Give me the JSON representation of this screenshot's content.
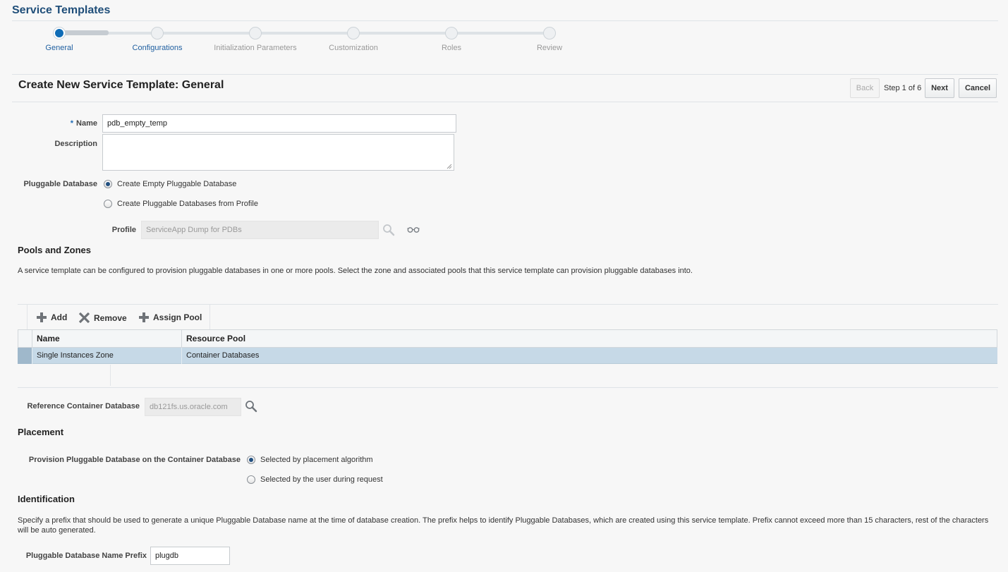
{
  "page_title": "Service Templates",
  "train": {
    "steps": [
      {
        "label": "General",
        "state": "active"
      },
      {
        "label": "Configurations",
        "state": "visited"
      },
      {
        "label": "Initialization Parameters",
        "state": "future"
      },
      {
        "label": "Customization",
        "state": "future"
      },
      {
        "label": "Roles",
        "state": "future"
      },
      {
        "label": "Review",
        "state": "future"
      }
    ]
  },
  "header": {
    "title": "Create New Service Template: General",
    "back_label": "Back",
    "step_text": "Step 1 of 6",
    "next_label": "Next",
    "cancel_label": "Cancel"
  },
  "form": {
    "required_mark": "*",
    "name_label": "Name",
    "name_value": "pdb_empty_temp",
    "description_label": "Description",
    "description_value": "",
    "pdb_label": "Pluggable Database",
    "pdb_options": [
      {
        "label": "Create Empty Pluggable Database",
        "selected": true
      },
      {
        "label": "Create Pluggable Databases from Profile",
        "selected": false
      }
    ],
    "profile_label": "Profile",
    "profile_value": "ServiceApp Dump for PDBs"
  },
  "pools": {
    "title": "Pools and Zones",
    "description": "A service template can be configured to provision pluggable databases in one or more pools. Select the zone and associated pools that this service template can provision pluggable databases into.",
    "toolbar": {
      "add": "Add",
      "remove": "Remove",
      "assign": "Assign Pool"
    },
    "columns": [
      "Name",
      "Resource Pool"
    ],
    "rows": [
      {
        "name": "Single Instances Zone",
        "pool": "Container Databases"
      }
    ]
  },
  "reference": {
    "label": "Reference Container Database",
    "value": "db121fs.us.oracle.com"
  },
  "placement": {
    "title": "Placement",
    "label": "Provision Pluggable Database on the Container Database",
    "options": [
      {
        "label": "Selected by placement algorithm",
        "selected": true
      },
      {
        "label": "Selected by the user during request",
        "selected": false
      }
    ]
  },
  "identification": {
    "title": "Identification",
    "description": "Specify a prefix that should be used to generate a unique Pluggable Database name at the time of database creation. The prefix helps to identify Pluggable Databases, which are created using this service template. Prefix cannot exceed more than 15 characters, rest of the characters will be auto generated.",
    "prefix_label": "Pluggable Database Name Prefix",
    "prefix_value": "plugdb"
  },
  "colors": {
    "accent": "#0f6cb6",
    "title": "#1f4e79",
    "selected_row": "#c6d9e7"
  }
}
